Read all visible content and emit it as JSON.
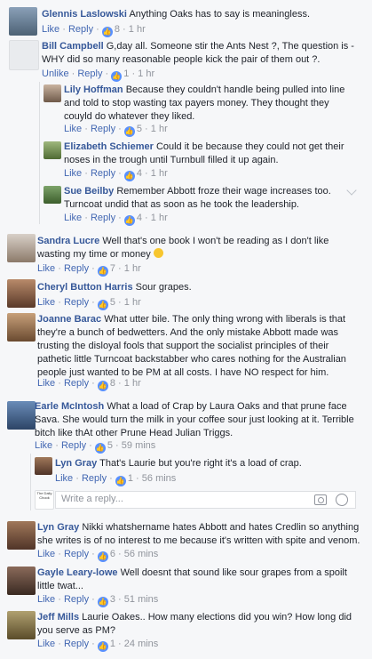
{
  "comments": [
    {
      "name": "Glennis Laslowski",
      "text": "Anything Oaks has to say is meaningless.",
      "actions": [
        "Like",
        "Reply"
      ],
      "likes": "8",
      "time": "1 hr"
    },
    {
      "name": "Bill Campbell",
      "text": "G,day all. Someone stir the Ants Nest ?, The question is -WHY did so many reasonable people kick the pair of them out ?.",
      "actions": [
        "Unlike",
        "Reply"
      ],
      "likes": "1",
      "time": "1 hr"
    },
    {
      "name": "Lily Hoffman",
      "text": "Because they couldn't handle being pulled into line and told to stop wasting tax payers money. They thought they couyld do whatever they liked.",
      "actions": [
        "Like",
        "Reply"
      ],
      "likes": "5",
      "time": "1 hr"
    },
    {
      "name": "Elizabeth Schiemer",
      "text": "Could it be because they could not get their noses in the trough until Turnbull filled it up again.",
      "actions": [
        "Like",
        "Reply"
      ],
      "likes": "4",
      "time": "1 hr"
    },
    {
      "name": "Sue Beilby",
      "text": "Remember Abbott froze their wage increases too. Turncoat undid that as soon as he took the leadership.",
      "actions": [
        "Like",
        "Reply"
      ],
      "likes": "4",
      "time": "1 hr"
    },
    {
      "name": "Sandra Lucre",
      "text": "Well that's one book I won't be reading as I don't like wasting my time or money",
      "actions": [
        "Like",
        "Reply"
      ],
      "likes": "7",
      "time": "1 hr"
    },
    {
      "name": "Cheryl Button Harris",
      "text": "Sour grapes.",
      "actions": [
        "Like",
        "Reply"
      ],
      "likes": "5",
      "time": "1 hr"
    },
    {
      "name": "Joanne Barac",
      "text": "What utter bile. The only thing wrong with liberals is that they're a bunch of bedwetters. And the only mistake Abbott made was trusting the disloyal fools that support the socialist principles of their pathetic little Turncoat backstabber who cares nothing for the Australian people just wanted to be PM at all costs. I have NO respect for him.",
      "actions": [
        "Like",
        "Reply"
      ],
      "likes": "8",
      "time": "1 hr"
    },
    {
      "name": "Earle McIntosh",
      "text": "What a load of Crap by Laura Oaks and that prune face Sava. She would turn the milk in your coffee sour just looking at it. Terrible bitch like thAt other Prune Head Julian Triggs.",
      "actions": [
        "Like",
        "Reply"
      ],
      "likes": "5",
      "time": "59 mins"
    },
    {
      "name": "Lyn Gray",
      "text": "That's Laurie but you're right it's a load of crap.",
      "actions": [
        "Like",
        "Reply"
      ],
      "likes": "1",
      "time": "56 mins"
    },
    {
      "name": "Lyn Gray",
      "text": "Nikki whatshername hates Abbott and hates Credlin so anything she writes is of no interest to me because it's written with spite and venom.",
      "actions": [
        "Like",
        "Reply"
      ],
      "likes": "6",
      "time": "56 mins"
    },
    {
      "name": "Gayle Leary-lowe",
      "text": "Well doesnt that sound like sour grapes from a spoilt little twat...",
      "actions": [
        "Like",
        "Reply"
      ],
      "likes": "3",
      "time": "51 mins"
    },
    {
      "name": "Jeff Mills",
      "text": "Laurie Oakes.. How many elections did you win? How long did you serve as PM?",
      "actions": [
        "Like",
        "Reply"
      ],
      "likes": "1",
      "time": "24 mins"
    }
  ],
  "reply_box": {
    "placeholder": "Write a reply...",
    "avatar_text": "The Daily Chook"
  },
  "colors": {
    "link": "#365899",
    "like_blue": "#5890ff",
    "meta": "#90949c"
  }
}
